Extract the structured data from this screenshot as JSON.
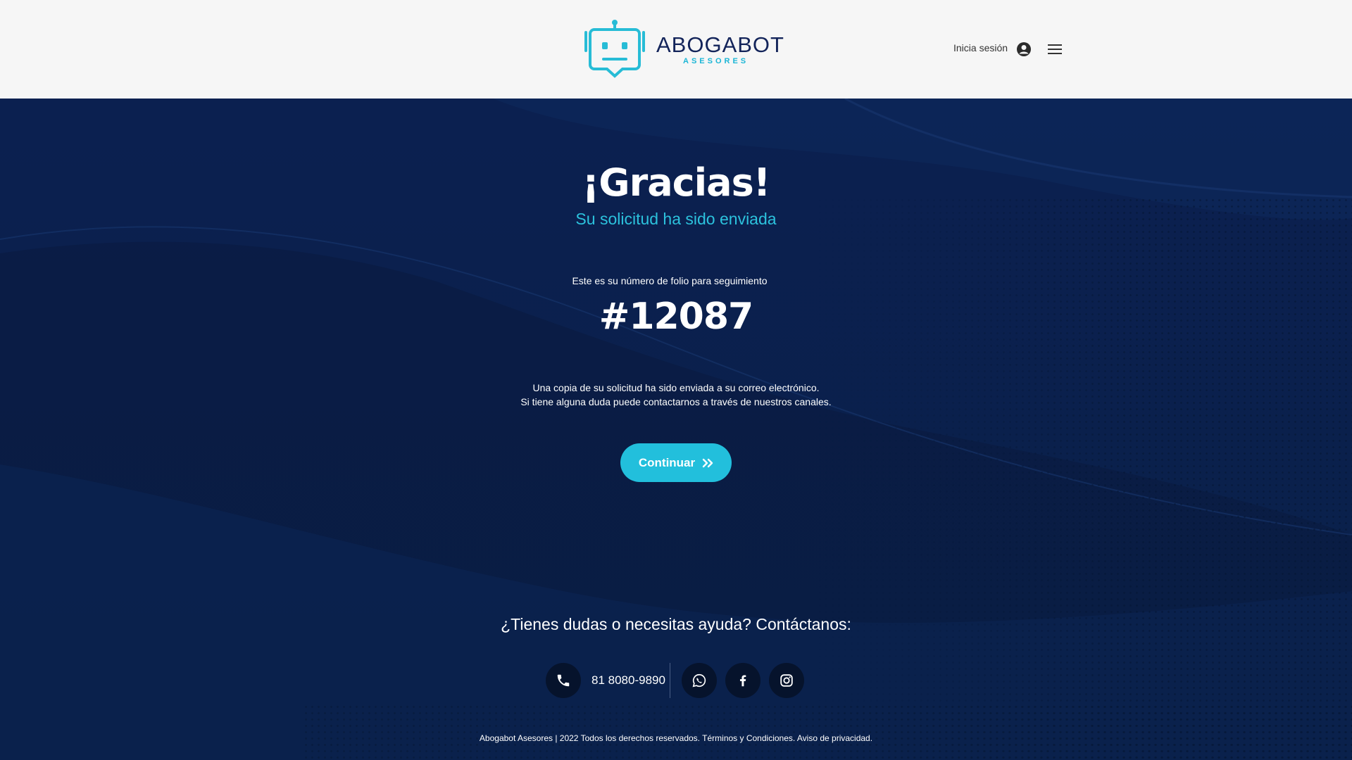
{
  "header": {
    "logo_name": "ABOGABOT",
    "logo_sub": "ASESORES",
    "login_label": "Inicia sesión",
    "icons": {
      "user": "user-circle-icon",
      "menu": "hamburger-menu-icon"
    }
  },
  "main": {
    "title": "¡Gracias!",
    "subtitle": "Su solicitud ha sido enviada",
    "folio_label": "Este es su número de folio para seguimiento",
    "folio_number": "#12087",
    "copy_line1": "Una copia de su solicitud ha sido enviada a su correo electrónico.",
    "copy_line2": "Si tiene alguna duda puede contactarnos a través de nuestros canales.",
    "continue_label": "Continuar"
  },
  "contact": {
    "heading": "¿Tienes dudas o necesitas ayuda? Contáctanos:",
    "phone": "81 8080-9890",
    "icons": [
      "phone-icon",
      "whatsapp-icon",
      "facebook-icon",
      "instagram-icon"
    ]
  },
  "footer": {
    "copyright": "Abogabot Asesores | 2022 Todos los derechos reservados.",
    "terms": "Términos y Condiciones.",
    "privacy": "Aviso de privacidad."
  },
  "colors": {
    "accent": "#22bfdc",
    "navy": "#0a2148",
    "brand_text": "#13245a",
    "header_bg": "#f6f6f6"
  }
}
